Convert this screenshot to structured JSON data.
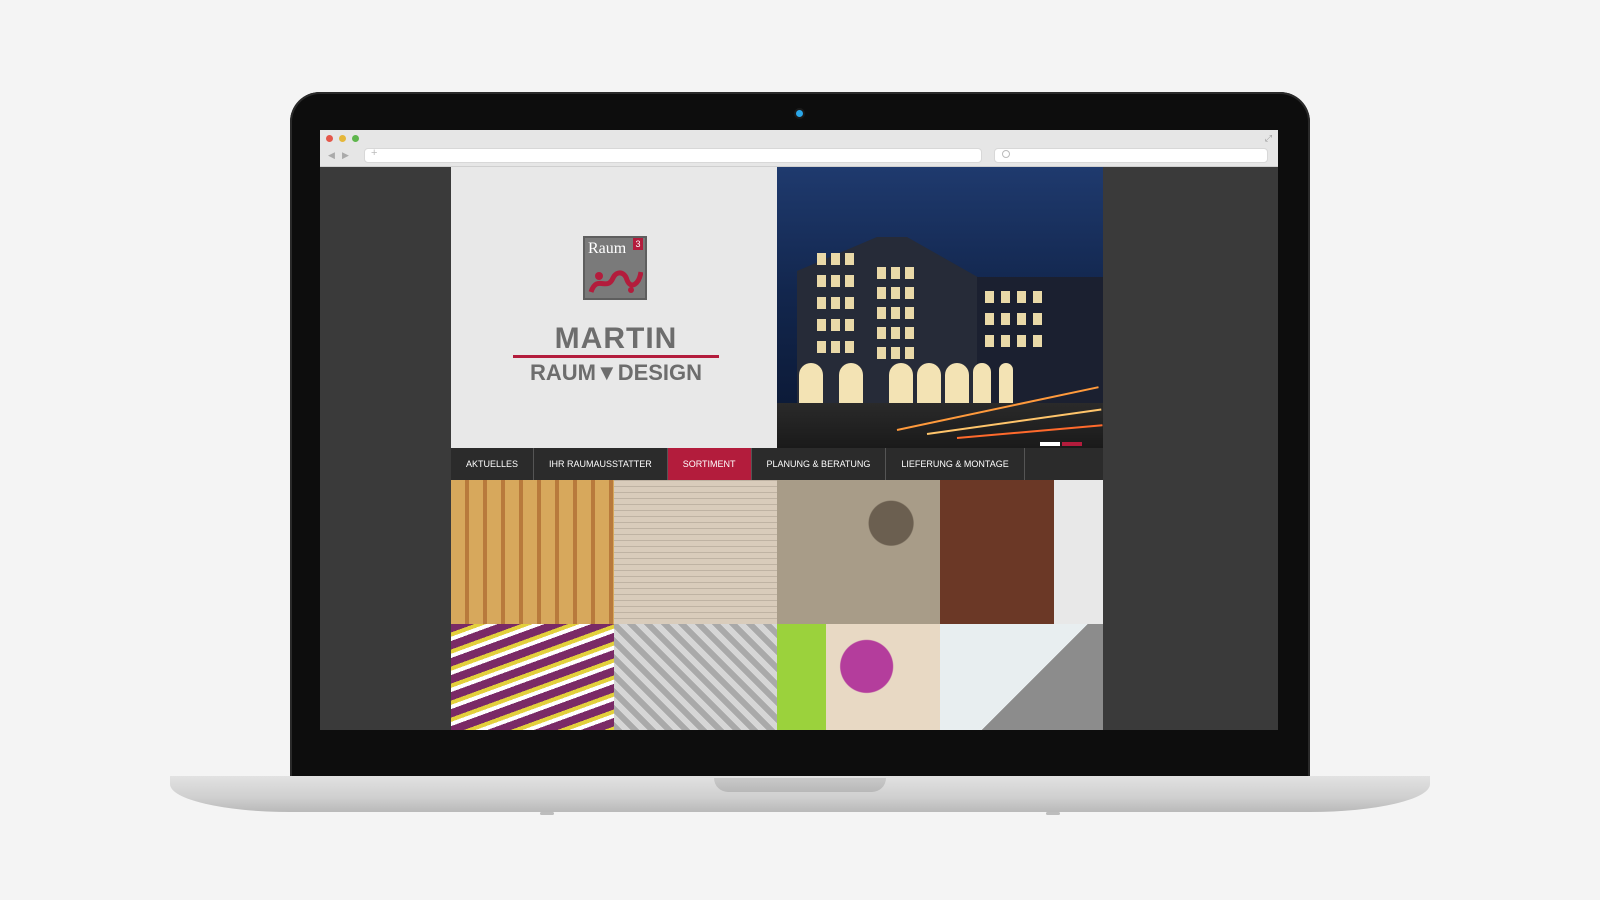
{
  "browser": {
    "window_controls": [
      "close-dot",
      "minimize-dot",
      "zoom-dot"
    ]
  },
  "site": {
    "logo": {
      "text": "Raum",
      "superscript": "3"
    },
    "brand": {
      "line1": "MARTIN",
      "line2": "RAUM▼DESIGN"
    },
    "menu": [
      {
        "label": "AKTUELLES",
        "active": false
      },
      {
        "label": "IHR RAUMAUSSTATTER",
        "active": false
      },
      {
        "label": "SORTIMENT",
        "active": true
      },
      {
        "label": "PLANUNG & BERATUNG",
        "active": false
      },
      {
        "label": "LIEFERUNG & MONTAGE",
        "active": false
      }
    ],
    "colors": {
      "accent": "#b31c3c",
      "menu_bg": "#2b2b2b",
      "hero_bg": "#e8e8e8"
    },
    "gallery": [
      {
        "name": "curtains",
        "colors": [
          "#d7a85c",
          "#b87a3c"
        ]
      },
      {
        "name": "pleated-blinds",
        "colors": [
          "#d9ccbb",
          "#ffffff"
        ]
      },
      {
        "name": "carpet-stones",
        "colors": [
          "#a89c88",
          "#6b5f50"
        ]
      },
      {
        "name": "parquet-floor",
        "colors": [
          "#6b3826",
          "#e8e8e8"
        ]
      },
      {
        "name": "striped-carpet",
        "colors": [
          "#7a2a66",
          "#e3d03c"
        ]
      },
      {
        "name": "upholstery-fabric",
        "colors": [
          "#a9a9a9",
          "#d6d6d6"
        ]
      },
      {
        "name": "floral-cushions",
        "colors": [
          "#b43d9c",
          "#9bd23c"
        ]
      },
      {
        "name": "doormat",
        "colors": [
          "#e8eef0",
          "#8c8c8c"
        ]
      }
    ]
  }
}
